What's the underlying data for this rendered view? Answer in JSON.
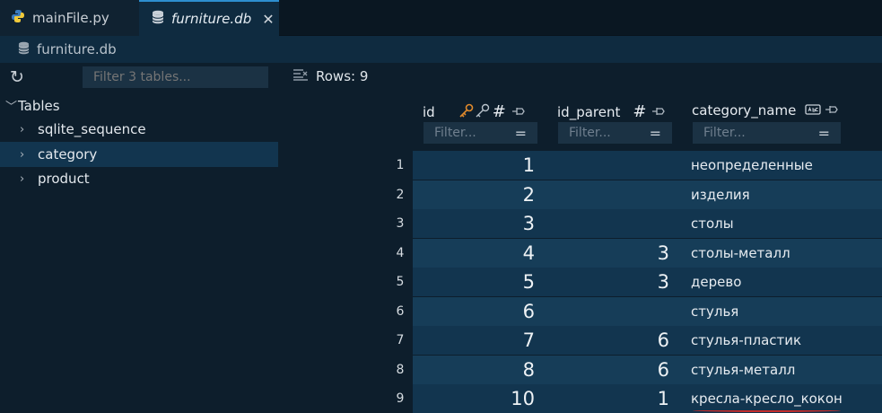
{
  "tabs": [
    {
      "label": "mainFile.py",
      "icon": "python-icon"
    },
    {
      "label": "furniture.db",
      "icon": "database-icon",
      "active": true
    }
  ],
  "breadcrumb": {
    "label": "furniture.db",
    "icon": "database-icon"
  },
  "sidebar": {
    "filter_placeholder": "Filter 3 tables...",
    "root_label": "Tables",
    "items": [
      {
        "label": "sqlite_sequence"
      },
      {
        "label": "category",
        "selected": true
      },
      {
        "label": "product"
      }
    ]
  },
  "main": {
    "rows_label": "Rows: 9",
    "columns": [
      {
        "name": "id",
        "filter_placeholder": "Filter..."
      },
      {
        "name": "id_parent",
        "filter_placeholder": "Filter..."
      },
      {
        "name": "category_name",
        "filter_placeholder": "Filter..."
      }
    ],
    "rows": [
      {
        "num": "1",
        "id": "1",
        "id_parent": "",
        "category_name": "неопределенные"
      },
      {
        "num": "2",
        "id": "2",
        "id_parent": "",
        "category_name": "изделия"
      },
      {
        "num": "3",
        "id": "3",
        "id_parent": "",
        "category_name": "столы"
      },
      {
        "num": "4",
        "id": "4",
        "id_parent": "3",
        "category_name": "столы-металл"
      },
      {
        "num": "5",
        "id": "5",
        "id_parent": "3",
        "category_name": "дерево"
      },
      {
        "num": "6",
        "id": "6",
        "id_parent": "",
        "category_name": "стулья"
      },
      {
        "num": "7",
        "id": "7",
        "id_parent": "6",
        "category_name": "стулья-пластик"
      },
      {
        "num": "8",
        "id": "8",
        "id_parent": "6",
        "category_name": "стулья-металл"
      },
      {
        "num": "9",
        "id": "10",
        "id_parent": "1",
        "category_name": "кресла-кресло_кокон"
      }
    ]
  },
  "colors": {
    "accent": "#2d8fd0",
    "key_icon": "#e08a2c",
    "error_underline": "#c42b2b"
  }
}
